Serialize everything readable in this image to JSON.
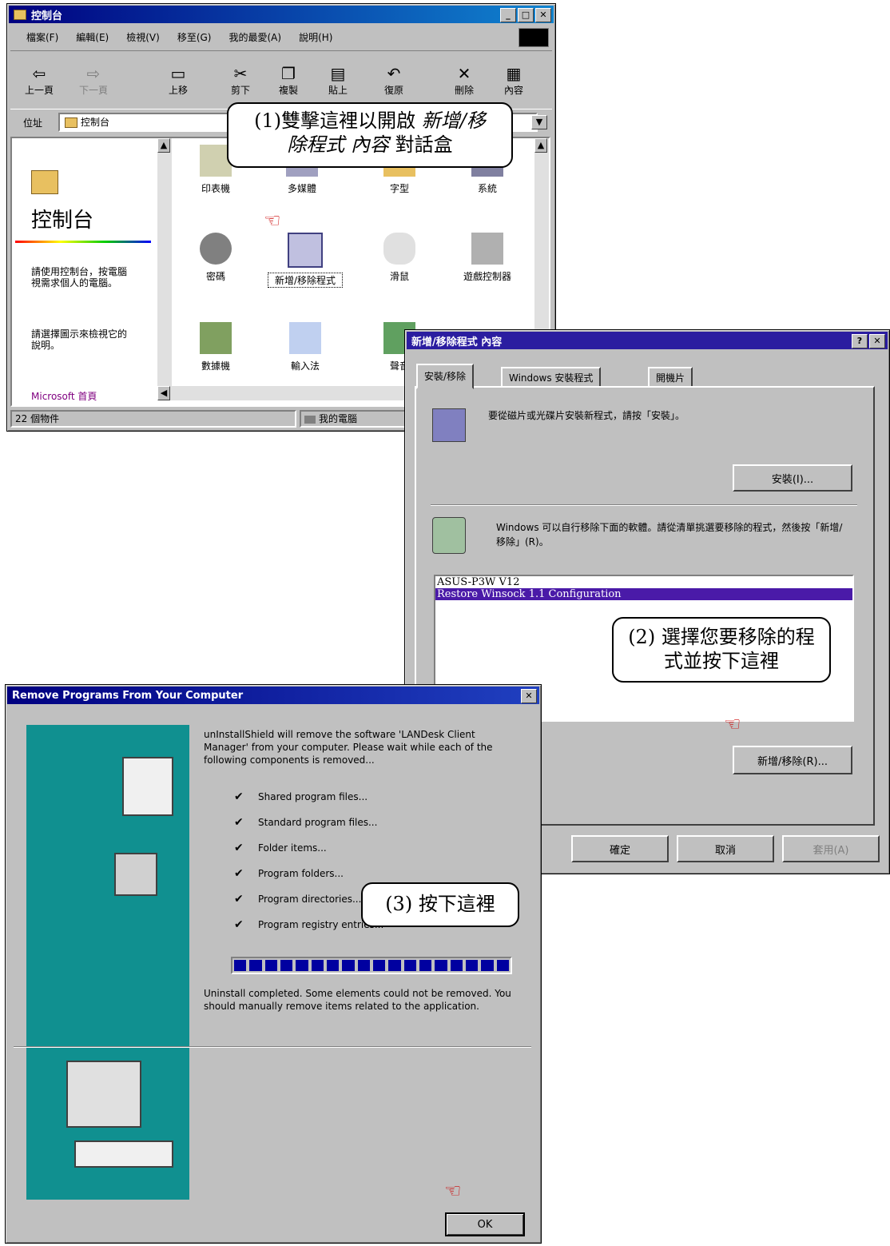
{
  "control_panel": {
    "title": "控制台",
    "menu": [
      "檔案(F)",
      "編輯(E)",
      "檢視(V)",
      "移至(G)",
      "我的最愛(A)",
      "說明(H)"
    ],
    "toolbar": [
      "上一頁",
      "下一頁",
      "上移",
      "剪下",
      "複製",
      "貼上",
      "復原",
      "刪除",
      "內容"
    ],
    "address_label": "位址",
    "address_value": "控制台",
    "sidebar_title": "控制台",
    "sidebar_text1": "請使用控制台，按電腦視需求個人的電腦。",
    "sidebar_text2": "請選擇圖示來檢視它的說明。",
    "sidebar_link": "Microsoft 首頁",
    "icons": [
      "印表機",
      "多媒體",
      "字型",
      "系統",
      "密碼",
      "新增/移除程式",
      "滑鼠",
      "遊戲控制器",
      "數據機",
      "輸入法",
      "聲音"
    ],
    "status_left": "22 個物件",
    "status_right": "我的電腦"
  },
  "callout1": {
    "prefix": "(1)雙擊這裡以開啟 ",
    "italic1": "新增/移",
    "line2_italic": "除程式 內容",
    "line2_rest": " 對話盒"
  },
  "dialog": {
    "title": "新增/移除程式 內容",
    "tabs": [
      "安裝/移除",
      "Windows 安裝程式",
      "開機片"
    ],
    "install_text": "要從磁片或光碟片安裝新程式，請按「安裝」。",
    "install_button": "安裝(I)...",
    "remove_text": "Windows 可以自行移除下面的軟體。請從清單挑選要移除的程式，然後按「新增/移除」(R)。",
    "programs": [
      "ASUS-P3W V12",
      "Restore Winsock 1.1 Configuration"
    ],
    "add_remove_button": "新增/移除(R)...",
    "ok": "確定",
    "cancel": "取消",
    "apply": "套用(A)"
  },
  "callout2": {
    "line1": "(2) 選擇您要移除的程",
    "line2": "式並按下這裡"
  },
  "uninstall": {
    "title": "Remove Programs From Your Computer",
    "intro": "unInstallShield will remove the software 'LANDesk Client Manager' from your computer. Please wait while each of the following components is removed...",
    "items": [
      "Shared program files...",
      "Standard program files...",
      "Folder items...",
      "Program folders...",
      "Program directories...",
      "Program registry entries..."
    ],
    "completed": "Uninstall completed. Some elements could not be removed. You should manually remove items related to the application.",
    "ok": "OK"
  },
  "callout3": {
    "text": "(3)  按下這裡"
  }
}
